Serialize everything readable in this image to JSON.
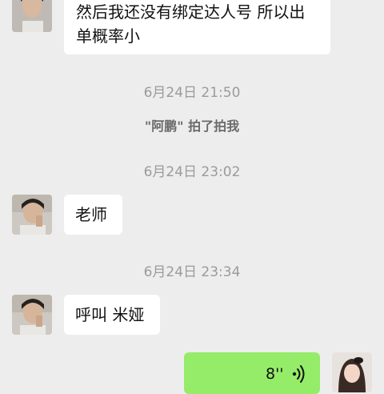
{
  "messages": [
    {
      "text": "然后我还没有绑定达人号 所以出单概率小"
    },
    {
      "timestamp": "6月24日 21:50"
    },
    {
      "system": "\"阿鹏\" 拍了拍我"
    },
    {
      "timestamp": "6月24日 23:02"
    },
    {
      "text": "老师"
    },
    {
      "timestamp": "6月24日 23:34"
    },
    {
      "text": "呼叫 米娅"
    },
    {
      "voice_duration": "8''"
    }
  ],
  "colors": {
    "background": "#ededed",
    "incoming_bubble": "#ffffff",
    "outgoing_bubble": "#95ec69"
  }
}
